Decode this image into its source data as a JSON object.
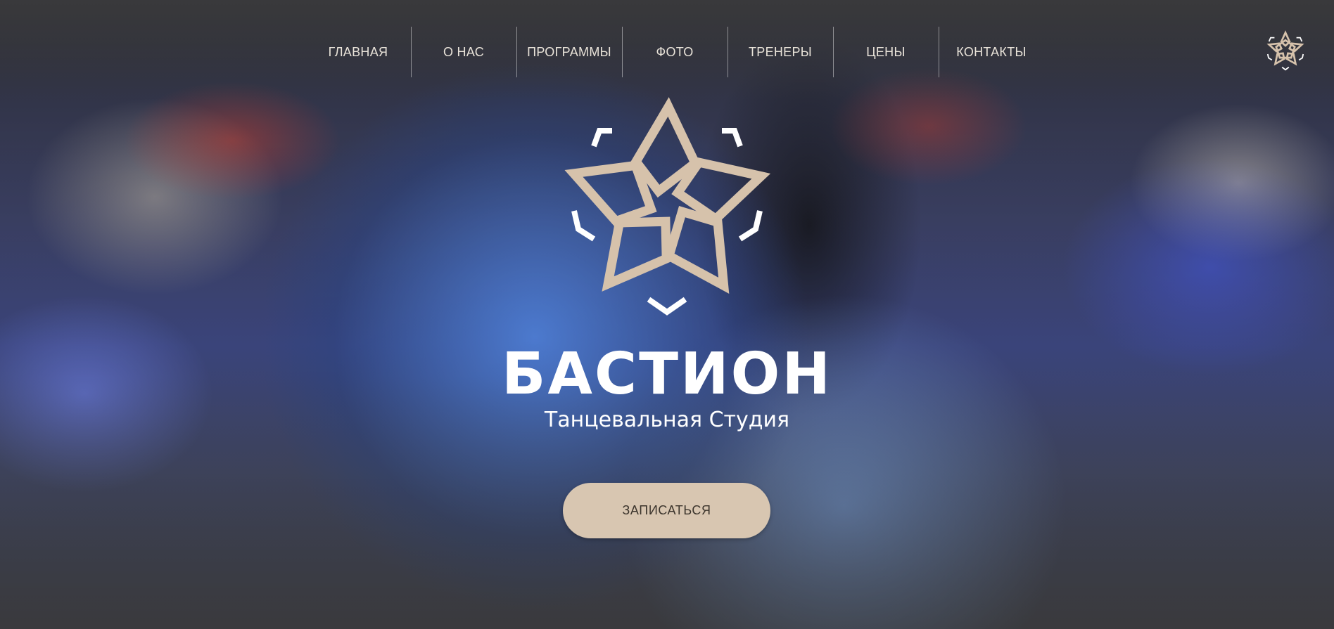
{
  "nav": {
    "items": [
      {
        "label": "ГЛАВНАЯ"
      },
      {
        "label": "О НАС"
      },
      {
        "label": "ПРОГРАММЫ"
      },
      {
        "label": "ФОТО"
      },
      {
        "label": "ТРЕНЕРЫ"
      },
      {
        "label": "ЦЕНЫ"
      },
      {
        "label": "КОНТАКТЫ"
      }
    ]
  },
  "brand": {
    "title": "БАСТИОН",
    "subtitle": "Танцевальная Студия",
    "logo_icon": "star-emblem-icon",
    "logo_color": "#d6c2ab"
  },
  "hero": {
    "cta_label": "ЗАПИСАТЬСЯ",
    "cta_color": "#d8c6b1"
  }
}
